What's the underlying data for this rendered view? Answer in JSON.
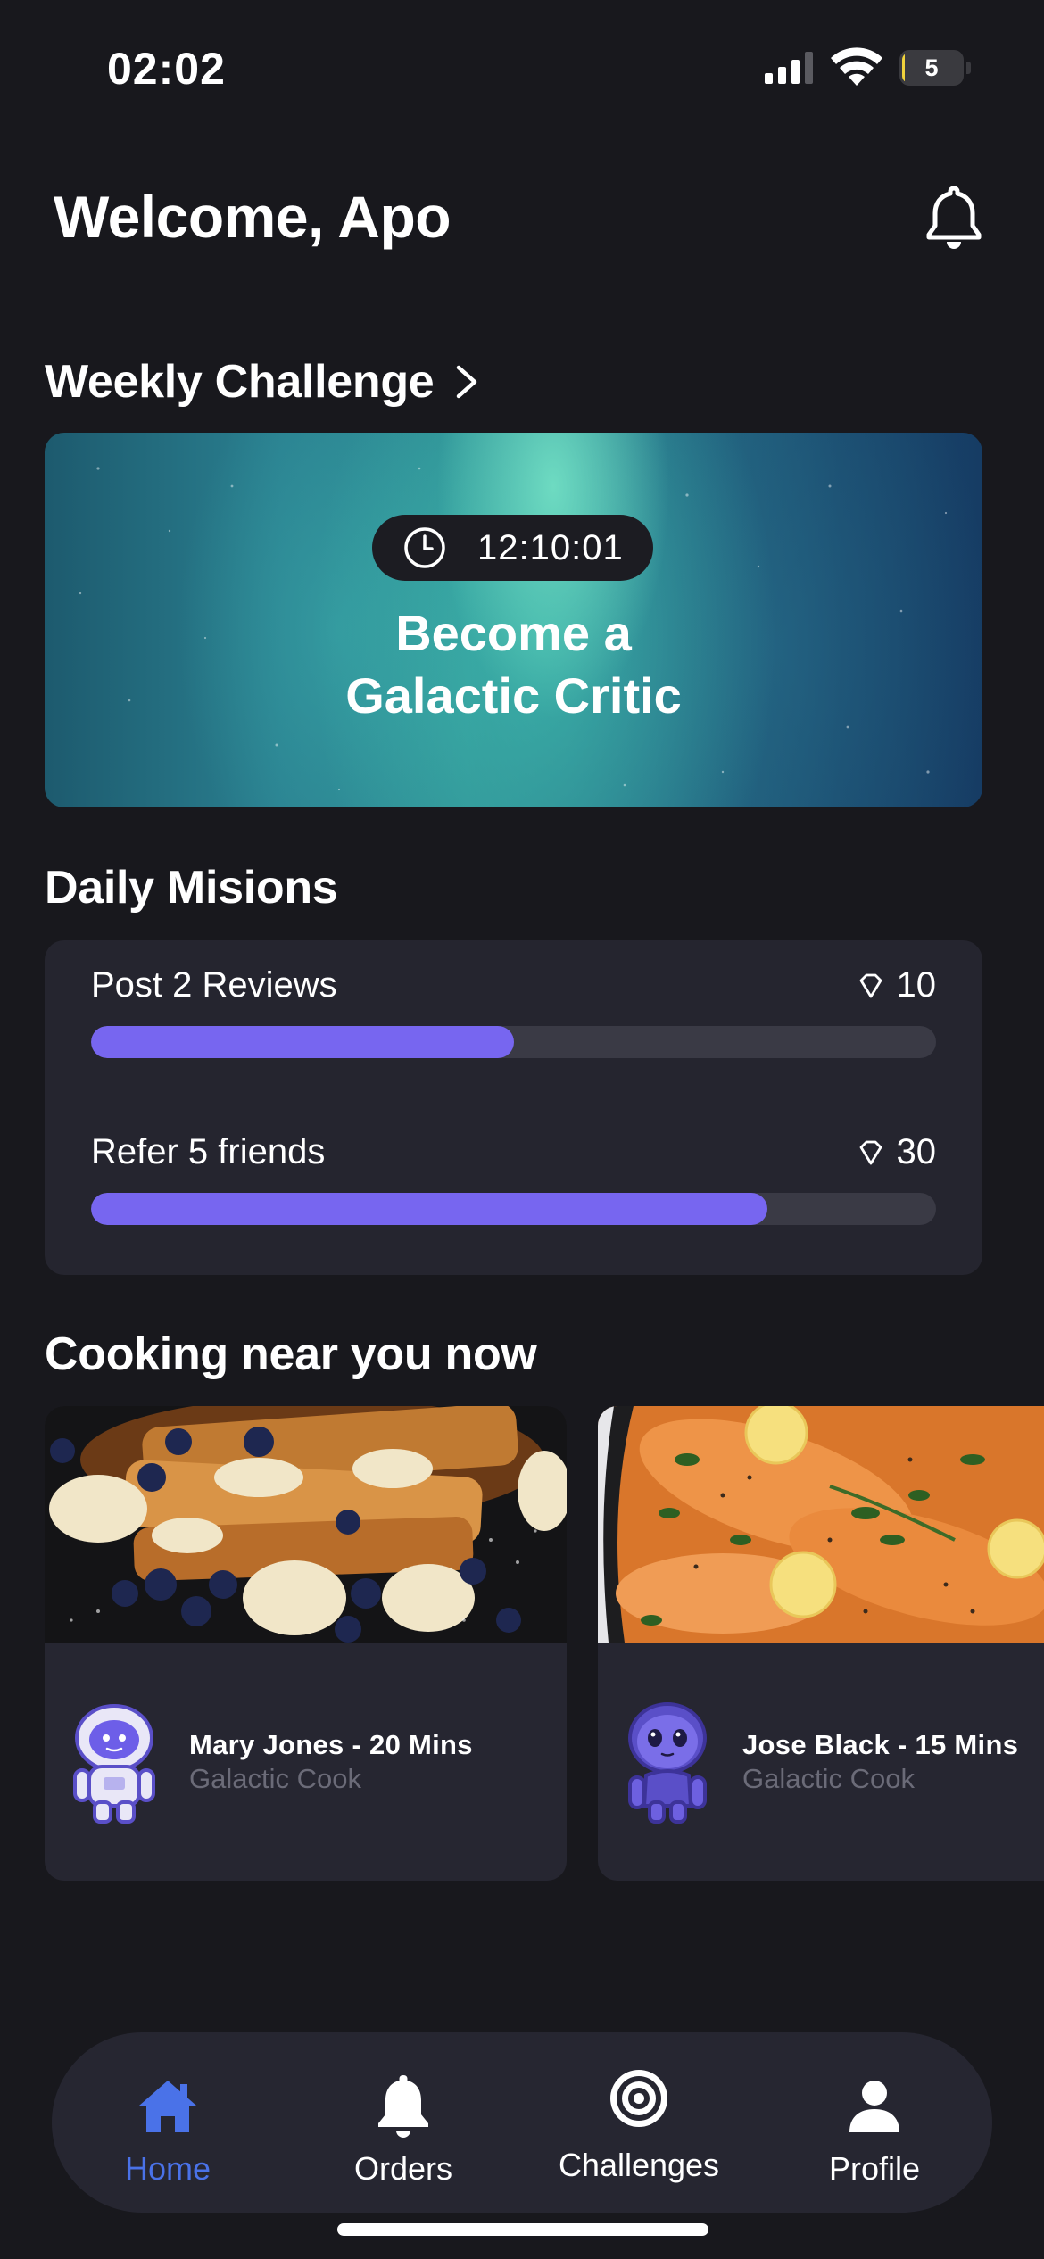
{
  "status_bar": {
    "time": "02:02",
    "battery_level": "5",
    "battery_color": "#f0d23c",
    "battery_fraction": 0.05
  },
  "header": {
    "welcome": "Welcome, Apo",
    "icon": "bell-icon"
  },
  "weekly_challenge": {
    "section_title": "Weekly Challenge",
    "timer": "12:10:01",
    "title": "Become a\nGalactic Critic"
  },
  "daily_missions": {
    "section_title": "Daily Misions",
    "accent_color": "#7766f0",
    "items": [
      {
        "label": "Post 2 Reviews",
        "reward": "10",
        "progress": 0.5
      },
      {
        "label": "Refer 5 friends",
        "reward": "30",
        "progress": 0.8
      }
    ]
  },
  "cooking_near": {
    "section_title": "Cooking near you now",
    "cooks": [
      {
        "name": "Mary Jones - 20 Mins",
        "role": "Galactic Cook",
        "photo": "french-toast-photo",
        "avatar": "astronaut-avatar"
      },
      {
        "name": "Jose Black - 15 Mins",
        "role": "Galactic Cook",
        "photo": "salmon-dish-photo",
        "avatar": "alien-avatar"
      }
    ]
  },
  "tab_bar": {
    "active_color": "#4a72e8",
    "tabs": [
      {
        "label": "Home",
        "icon": "home-icon",
        "active": true
      },
      {
        "label": "Orders",
        "icon": "bell-icon",
        "active": false
      },
      {
        "label": "Challenges",
        "icon": "target-icon",
        "active": false
      },
      {
        "label": "Profile",
        "icon": "person-icon",
        "active": false
      }
    ]
  }
}
